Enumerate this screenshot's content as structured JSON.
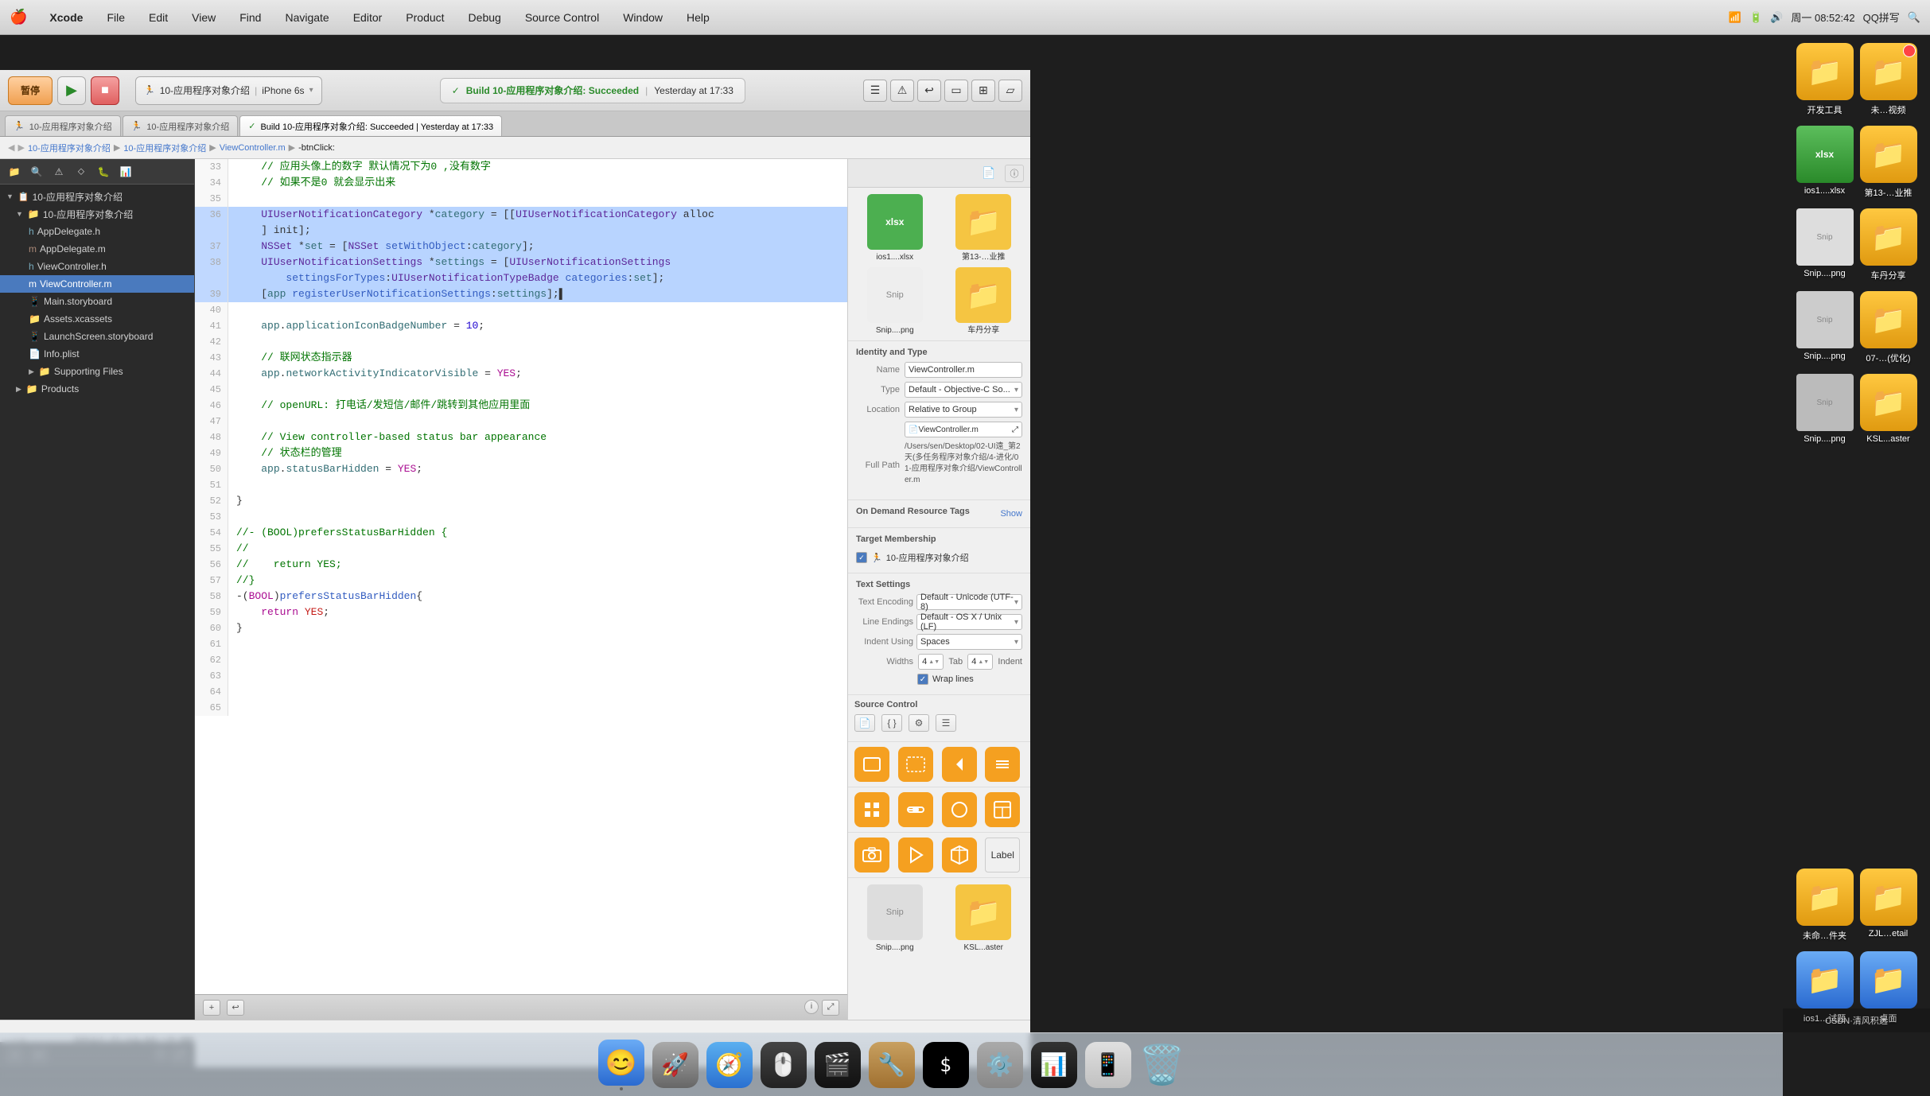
{
  "menubar": {
    "apple": "🍎",
    "items": [
      "Xcode",
      "File",
      "Edit",
      "View",
      "Find",
      "Navigate",
      "Editor",
      "Product",
      "Debug",
      "Source Control",
      "Window",
      "Help"
    ],
    "right": {
      "search_icon": "🔍",
      "time": "周一 08:52:42",
      "wifi": "WiFi",
      "battery": "🔋",
      "qq": "QQ拼写"
    }
  },
  "toolbar": {
    "pause_label": "暂停",
    "run_icon": "▶",
    "stop_icon": "■",
    "scheme": "10-应用程序对象介绍",
    "device": "iPhone 6s",
    "build_status": "Build 10-应用程序对象介绍: Succeeded",
    "build_time": "Yesterday at 17:33"
  },
  "tabs": [
    {
      "label": "10-应用程序对象介绍",
      "active": false
    },
    {
      "label": "10-应用程序对象介绍",
      "active": false
    },
    {
      "label": "Build 10-应用程序对象介绍: Succeeded | Yesterday at 17:33",
      "active": true
    }
  ],
  "breadcrumb": {
    "items": [
      "10-应用程序对象介绍",
      "10-应用程序对象介绍",
      "ViewController.m",
      "-btnClick:"
    ]
  },
  "sidebar": {
    "project_name": "10-应用程序对象介绍",
    "files": [
      {
        "name": "10-应用程序对象介绍",
        "level": 1,
        "expanded": true,
        "type": "group"
      },
      {
        "name": "AppDelegate.h",
        "level": 2,
        "type": "file",
        "icon": "📄"
      },
      {
        "name": "AppDelegate.m",
        "level": 2,
        "type": "file",
        "icon": "📄"
      },
      {
        "name": "ViewController.h",
        "level": 2,
        "type": "file",
        "icon": "📄"
      },
      {
        "name": "ViewController.m",
        "level": 2,
        "type": "file",
        "icon": "📄",
        "selected": true
      },
      {
        "name": "Main.storyboard",
        "level": 2,
        "type": "file",
        "icon": "📱"
      },
      {
        "name": "Assets.xcassets",
        "level": 2,
        "type": "folder",
        "icon": "📁"
      },
      {
        "name": "LaunchScreen.storyboard",
        "level": 2,
        "type": "file",
        "icon": "📱"
      },
      {
        "name": "Info.plist",
        "level": 2,
        "type": "file",
        "icon": "📄"
      },
      {
        "name": "Supporting Files",
        "level": 2,
        "type": "folder",
        "icon": "📁"
      },
      {
        "name": "Products",
        "level": 1,
        "type": "group",
        "icon": "📁"
      }
    ]
  },
  "code": {
    "lines": [
      {
        "num": 33,
        "content": "    // 应用头像上的数字 默认情况下为0 ,没有数字",
        "selected": false,
        "type": "comment"
      },
      {
        "num": 34,
        "content": "    // 如果不是0 就会显示出来",
        "selected": false,
        "type": "comment"
      },
      {
        "num": 35,
        "content": "",
        "selected": false
      },
      {
        "num": 36,
        "content": "    UIUserNotificationCategory *category = [[UIUserNotificationCategory alloc]",
        "selected": true,
        "type": "code"
      },
      {
        "num": 36,
        "content": "    ] init];",
        "selected": true,
        "type": "code",
        "continuation": true
      },
      {
        "num": 37,
        "content": "    NSSet *set = [NSSet setWithObject:category];",
        "selected": true,
        "type": "code"
      },
      {
        "num": 38,
        "content": "    UIUserNotificationSettings *settings = [UIUserNotificationSettings",
        "selected": true,
        "type": "code"
      },
      {
        "num": 38,
        "content": "        settingsForTypes:UIUserNotificationTypeBadge categories:set];",
        "selected": true,
        "type": "code",
        "continuation": true
      },
      {
        "num": 39,
        "content": "    [app registerUserNotificationSettings:settings];",
        "selected": true,
        "type": "code"
      },
      {
        "num": 40,
        "content": "",
        "selected": false
      },
      {
        "num": 41,
        "content": "    app.applicationIconBadgeNumber = 10;",
        "selected": false,
        "type": "code"
      },
      {
        "num": 42,
        "content": "",
        "selected": false
      },
      {
        "num": 43,
        "content": "    // 联网状态指示器",
        "selected": false,
        "type": "comment"
      },
      {
        "num": 44,
        "content": "    app.networkActivityIndicatorVisible = YES;",
        "selected": false,
        "type": "code"
      },
      {
        "num": 45,
        "content": "",
        "selected": false
      },
      {
        "num": 46,
        "content": "    // openURL: 打电话/发短信/邮件/跳转到其他应用里面",
        "selected": false,
        "type": "comment"
      },
      {
        "num": 47,
        "content": "",
        "selected": false
      },
      {
        "num": 48,
        "content": "    // View controller-based status bar appearance",
        "selected": false,
        "type": "comment"
      },
      {
        "num": 49,
        "content": "    // 状态栏的管理",
        "selected": false,
        "type": "comment"
      },
      {
        "num": 50,
        "content": "    app.statusBarHidden = YES;",
        "selected": false,
        "type": "code"
      },
      {
        "num": 51,
        "content": "",
        "selected": false
      },
      {
        "num": 52,
        "content": "}",
        "selected": false,
        "type": "code"
      },
      {
        "num": 53,
        "content": "",
        "selected": false
      },
      {
        "num": 54,
        "content": "//- (BOOL)prefersStatusBarHidden {",
        "selected": false,
        "type": "comment"
      },
      {
        "num": 55,
        "content": "//",
        "selected": false,
        "type": "comment"
      },
      {
        "num": 56,
        "content": "//    return YES;",
        "selected": false,
        "type": "comment"
      },
      {
        "num": 57,
        "content": "//}",
        "selected": false,
        "type": "comment"
      },
      {
        "num": 58,
        "content": "-(BOOL)prefersStatusBarHidden{",
        "selected": false,
        "type": "code"
      },
      {
        "num": 59,
        "content": "    return YES;",
        "selected": false,
        "type": "code"
      },
      {
        "num": 60,
        "content": "}",
        "selected": false,
        "type": "code"
      },
      {
        "num": 61,
        "content": "",
        "selected": false
      },
      {
        "num": 62,
        "content": "",
        "selected": false
      },
      {
        "num": 63,
        "content": "",
        "selected": false
      },
      {
        "num": 64,
        "content": "",
        "selected": false
      },
      {
        "num": 65,
        "content": "",
        "selected": false
      }
    ]
  },
  "inspector": {
    "identity_type": {
      "title": "Identity and Type",
      "name_label": "Name",
      "name_value": "ViewController.m",
      "type_label": "Type",
      "type_value": "Default - Objective-C So...",
      "location_label": "Location",
      "location_value": "Relative to Group",
      "location_file": "ViewController.m",
      "full_path_label": "Full Path",
      "full_path_value": "/Users/sen/Desktop/02-UI遠_第2天(多任务程序对象介绍/4-进化/01-应用程序对象介绍/ViewController.m"
    },
    "on_demand": {
      "title": "On Demand Resource Tags",
      "show_label": "Show"
    },
    "target_membership": {
      "title": "Target Membership",
      "target_name": "10-应用程序对象介绍"
    },
    "text_settings": {
      "title": "Text Settings",
      "encoding_label": "Text Encoding",
      "encoding_value": "Default - Unicode (UTF-8)",
      "line_endings_label": "Line Endings",
      "line_endings_value": "Default - OS X / Unix (LF)",
      "indent_using_label": "Indent Using",
      "indent_using_value": "Spaces",
      "widths_label": "Widths",
      "tab_label": "Tab",
      "indent_label": "Indent",
      "tab_value": "4",
      "indent_value": "4",
      "wrap_lines_label": "Wrap lines"
    },
    "source_control": {
      "title": "Source Control"
    },
    "file_grid": [
      {
        "name": "ios1....xlsx",
        "type": "xlsx"
      },
      {
        "name": "第13-…业推",
        "type": "folder_yellow"
      },
      {
        "name": "Snip....png",
        "type": "png"
      },
      {
        "name": "车丹分享",
        "type": "folder_yellow"
      },
      {
        "name": "Snip....png",
        "type": "png"
      },
      {
        "name": "07-…(优化)",
        "type": "folder_yellow"
      },
      {
        "name": "Snip....png",
        "type": "png"
      },
      {
        "name": "KSL...aster",
        "type": "folder_yellow"
      }
    ],
    "obj_lib": {
      "icons": [
        {
          "type": "orange_square",
          "symbol": "□"
        },
        {
          "type": "orange_dotted",
          "symbol": "⊡"
        },
        {
          "type": "orange_back",
          "symbol": "◀"
        },
        {
          "type": "orange_list",
          "symbol": "≡"
        },
        {
          "type": "orange_grid",
          "symbol": "⊞"
        },
        {
          "type": "orange_slider",
          "symbol": "⊟"
        },
        {
          "type": "orange_circle",
          "symbol": "◎"
        },
        {
          "type": "orange_container",
          "symbol": "▦"
        },
        {
          "type": "orange_camera",
          "symbol": "📷"
        },
        {
          "type": "orange_play",
          "symbol": "▷"
        },
        {
          "type": "orange_cube",
          "symbol": "⬡"
        },
        {
          "type": "label_text",
          "symbol": "Label"
        }
      ]
    },
    "desktop_files": [
      {
        "name": "未命…件夹",
        "type": "folder_yellow"
      },
      {
        "name": "ZJL…etail",
        "type": "folder_yellow"
      },
      {
        "name": "ios1…试题",
        "type": "folder_blue"
      },
      {
        "name": "桌面",
        "type": "folder_blue"
      }
    ]
  },
  "status_bar_text": "iber: 初始化功能设置",
  "dock_items": [
    {
      "icon": "🔍",
      "name": "Finder",
      "label": ""
    },
    {
      "icon": "🚀",
      "name": "Launchpad",
      "label": ""
    },
    {
      "icon": "🌐",
      "name": "Safari",
      "label": ""
    },
    {
      "icon": "🖱️",
      "name": "Mouse",
      "label": ""
    },
    {
      "icon": "🎬",
      "name": "QuickTime",
      "label": ""
    },
    {
      "icon": "🔧",
      "name": "Tools",
      "label": ""
    },
    {
      "icon": "⬛",
      "name": "Terminal",
      "label": ""
    },
    {
      "icon": "⚙️",
      "name": "SystemPrefs",
      "label": ""
    },
    {
      "icon": "🎭",
      "name": "iStat",
      "label": ""
    },
    {
      "icon": "📱",
      "name": "Simulator",
      "label": ""
    },
    {
      "icon": "🗑️",
      "name": "Trash",
      "label": ""
    }
  ],
  "colors": {
    "selection_bg": "#b8d4ff",
    "sidebar_bg": "#2a2a2a",
    "editor_bg": "#ffffff",
    "toolbar_bg": "#e0e0e0",
    "accent": "#4a7abe",
    "comment_green": "#007400",
    "keyword_purple": "#aa0d91",
    "string_red": "#c41a16",
    "number_blue": "#1c00cf"
  }
}
